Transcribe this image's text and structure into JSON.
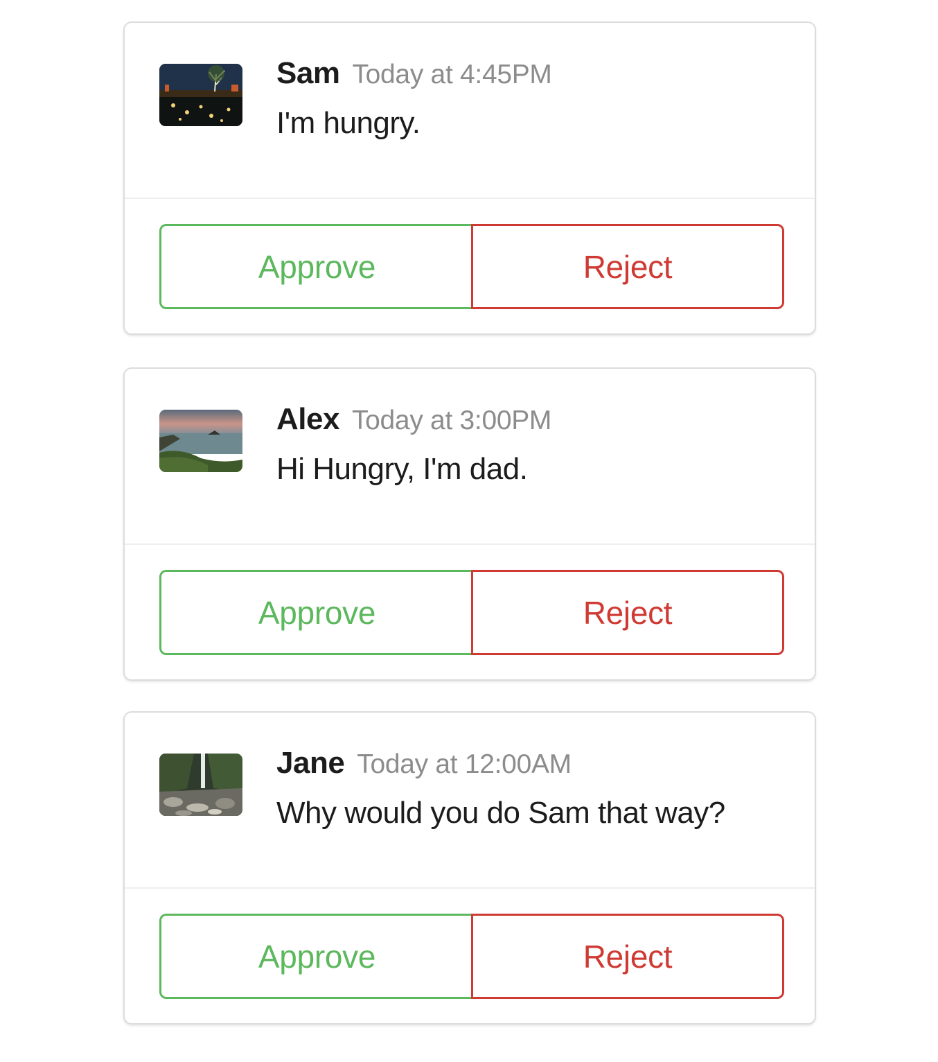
{
  "messages": [
    {
      "author": "Sam",
      "timestamp": "Today at 4:45PM",
      "text": "I'm hungry.",
      "approve_label": "Approve",
      "reject_label": "Reject"
    },
    {
      "author": "Alex",
      "timestamp": "Today at 3:00PM",
      "text": "Hi Hungry, I'm dad.",
      "approve_label": "Approve",
      "reject_label": "Reject"
    },
    {
      "author": "Jane",
      "timestamp": "Today at 12:00AM",
      "text": "Why would you do Sam that way?",
      "approve_label": "Approve",
      "reject_label": "Reject"
    }
  ],
  "colors": {
    "approve": "#5cb85c",
    "reject": "#cf3a33",
    "timestamp": "#8c8c8c",
    "text": "#1d1c1d"
  },
  "avatars": [
    "night-park-photo",
    "coastal-sunset-photo",
    "waterfall-rocks-photo"
  ]
}
